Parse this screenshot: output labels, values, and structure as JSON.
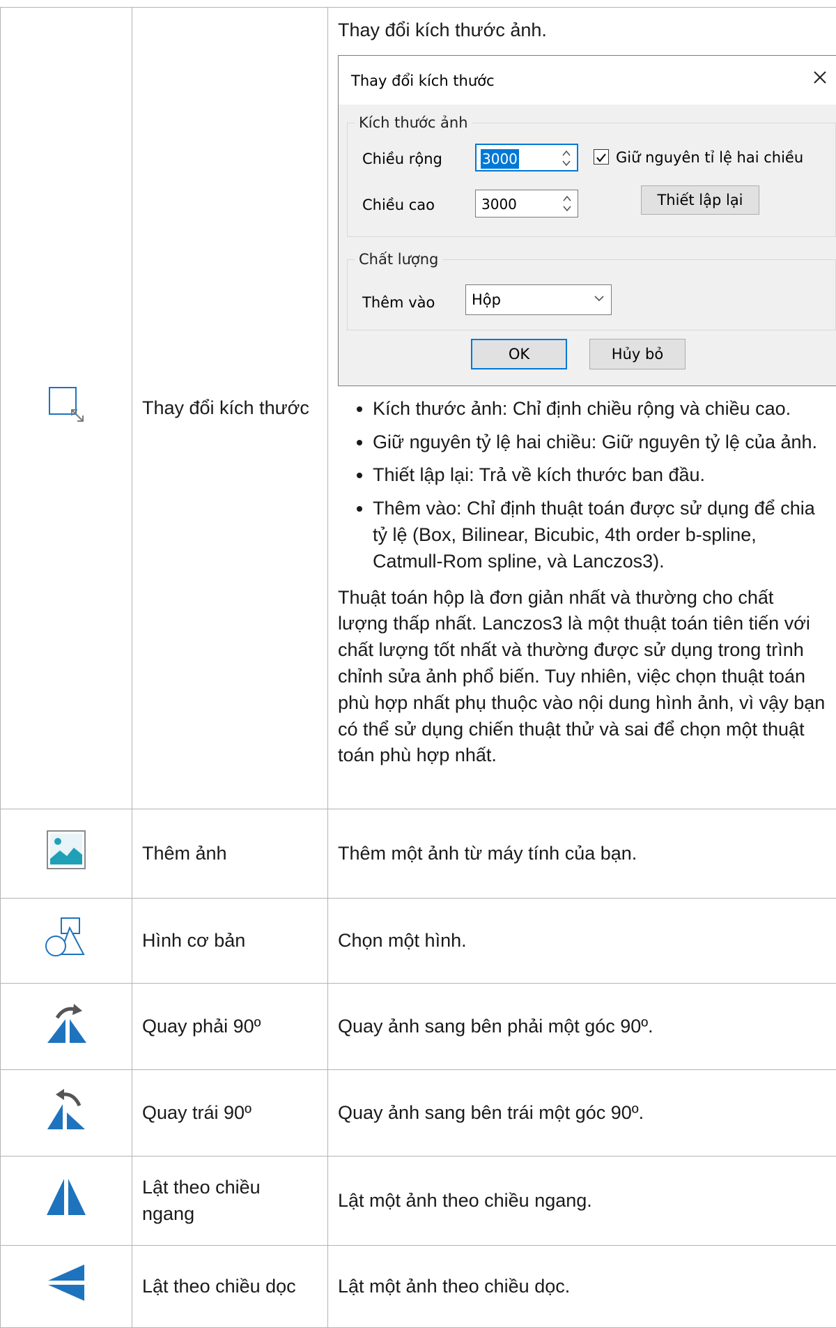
{
  "rows": [
    {
      "icon": "resize-icon",
      "name": "Thay đổi kích thước",
      "intro": "Thay đổi kích thước ảnh.",
      "dialog": {
        "title": "Thay đổi kích thước",
        "group_size": "Kích thước ảnh",
        "width_label": "Chiều rộng",
        "width_value": "3000",
        "height_label": "Chiều cao",
        "height_value": "3000",
        "keep_ratio_label": "Giữ nguyên tỉ lệ hai chiều",
        "keep_ratio_checked": true,
        "reset_label": "Thiết lập lại",
        "group_quality": "Chất lượng",
        "add_label": "Thêm vào",
        "add_value": "Hộp",
        "ok_label": "OK",
        "cancel_label": "Hủy bỏ"
      },
      "bullets": [
        "Kích thước ảnh: Chỉ định chiều rộng và chiều cao.",
        "Giữ nguyên tỷ lệ hai chiều: Giữ nguyên tỷ lệ của ảnh.",
        "Thiết lập lại: Trả về kích thước ban đầu.",
        "Thêm vào: Chỉ định thuật toán được sử dụng để chia tỷ lệ (Box, Bilinear, Bicubic, 4th order b-spline, Catmull-Rom spline, và Lanczos3)."
      ],
      "after": "Thuật toán hộp là đơn giản nhất và thường cho chất lượng thấp nhất. Lanczos3 là một thuật toán tiên tiến với chất lượng tốt nhất và thường được sử dụng trong trình chỉnh sửa ảnh phổ biến. Tuy nhiên, việc chọn thuật toán phù hợp nhất phụ thuộc vào nội dung hình ảnh, vì vậy bạn có thể sử dụng chiến thuật thử và sai để chọn một thuật toán phù hợp nhất."
    },
    {
      "icon": "image-icon",
      "name": "Thêm ảnh",
      "desc": "Thêm một ảnh từ máy tính của bạn."
    },
    {
      "icon": "shapes-icon",
      "name": "Hình cơ bản",
      "desc": "Chọn một hình."
    },
    {
      "icon": "rotate-right-icon",
      "name": "Quay phải 90º",
      "desc": "Quay ảnh sang bên phải một góc 90º."
    },
    {
      "icon": "rotate-left-icon",
      "name": "Quay trái 90º",
      "desc": "Quay ảnh sang bên trái một góc 90º."
    },
    {
      "icon": "flip-horizontal-icon",
      "name": "Lật theo chiều ngang",
      "desc": "Lật một ảnh theo chiều ngang."
    },
    {
      "icon": "flip-vertical-icon",
      "name": "Lật theo chiều dọc",
      "desc": "Lật một ảnh theo chiều dọc."
    }
  ],
  "colors": {
    "icon_blue": "#1e73be",
    "icon_teal": "#1fa0b7",
    "border": "#b3b3b3"
  }
}
